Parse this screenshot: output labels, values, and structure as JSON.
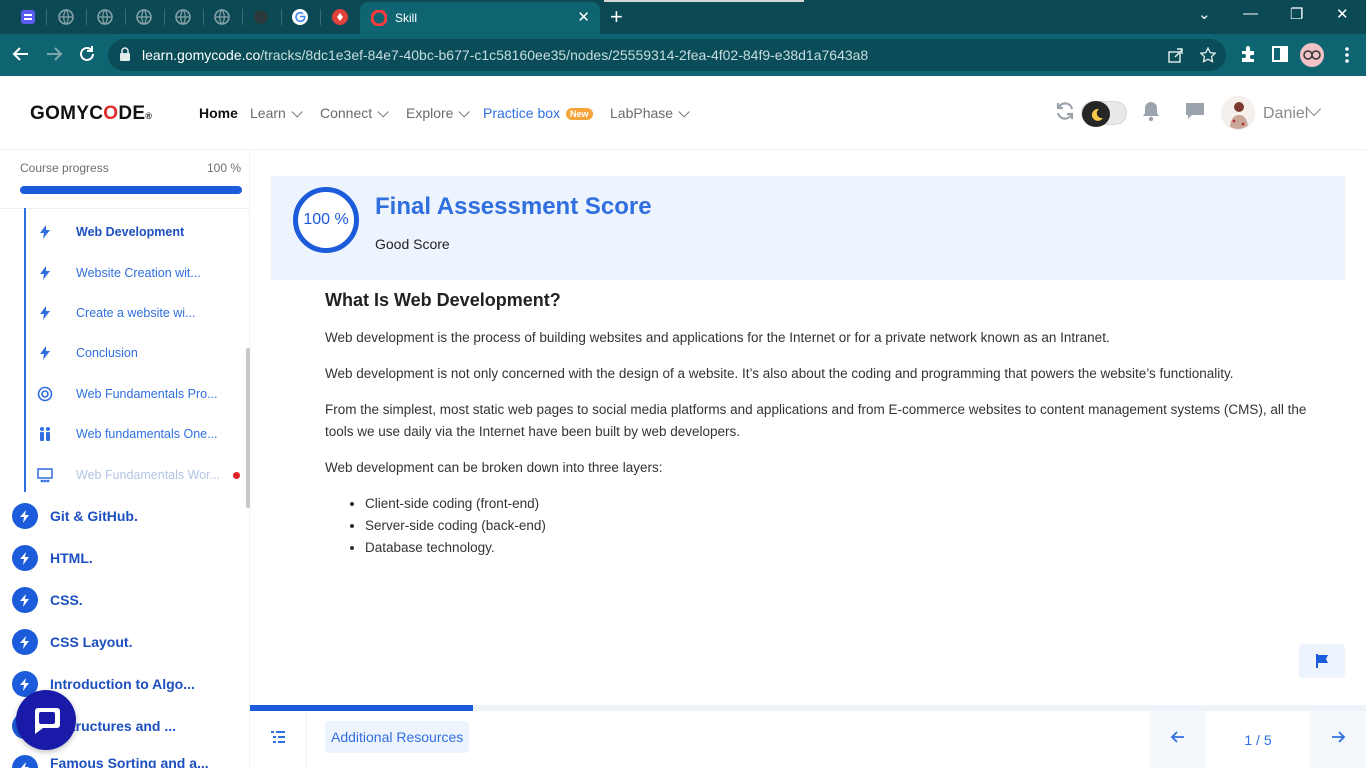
{
  "browser": {
    "active_tab_title": "Skill",
    "url_host": "learn.gomycode.co",
    "url_path": "/tracks/8dc1e3ef-84e7-40bc-b677-c1c58160ee35/nodes/25559314-2fea-4f02-84f9-e38d1a7643a8",
    "new_tab_symbol": "+",
    "close_symbol": "✕",
    "minimize_symbol": "—",
    "restore_symbol": "❐",
    "window_close_symbol": "✕",
    "tab_list_symbol": "⌄"
  },
  "header": {
    "logo_pre": "GOMYC",
    "logo_o": "O",
    "logo_post": "DE",
    "logo_reg": "®",
    "nav": {
      "home": "Home",
      "learn": "Learn",
      "connect": "Connect",
      "explore": "Explore",
      "practice": "Practice box",
      "practice_badge": "New",
      "labphase": "LabPhase"
    },
    "user_name": "Daniel"
  },
  "sidebar": {
    "progress_label": "Course progress",
    "progress_value": "100 %",
    "progress_fraction": 1.0,
    "sub_items": [
      {
        "label": "Web Development",
        "icon": "bolt-icon"
      },
      {
        "label": "Website Creation wit...",
        "icon": "bolt-icon"
      },
      {
        "label": "Create a website wi...",
        "icon": "bolt-icon"
      },
      {
        "label": "Conclusion",
        "icon": "bolt-icon"
      },
      {
        "label": "Web Fundamentals Pro...",
        "icon": "target-icon"
      },
      {
        "label": "Web fundamentals One...",
        "icon": "people-icon"
      },
      {
        "label": "Web Fundamentals Wor...",
        "icon": "workshop-icon"
      }
    ],
    "modules": [
      {
        "label": "Git & GitHub."
      },
      {
        "label": "HTML."
      },
      {
        "label": "CSS."
      },
      {
        "label": "CSS Layout."
      },
      {
        "label": "Introduction to Algo..."
      },
      {
        "label": "a Structures and ..."
      },
      {
        "label": "Famous Sorting and a..."
      }
    ]
  },
  "score": {
    "percent": "100 %",
    "title": "Final Assessment Score",
    "subtitle": "Good Score"
  },
  "article": {
    "heading": "What Is Web Development?",
    "paragraphs": [
      "Web development is the process of building websites and applications for the Internet or for a private network known as an Intranet.",
      "Web development is not only concerned with the design of a website. It’s also about the coding and programming that powers the website’s functionality.",
      "From the simplest, most static web pages to social media platforms and applications and from E-commerce websites to content management systems (CMS), all the tools we use daily via the Internet have been built by web developers.",
      "Web development can be broken down into three layers:"
    ],
    "bullets": [
      "Client-side coding (front-end)",
      "Server-side coding (back-end)",
      "Database technology."
    ]
  },
  "bottom": {
    "resources_label": "Additional Resources",
    "page_indicator": "1 / 5",
    "page_progress_fraction": 0.2
  },
  "colors": {
    "primary": "#1c5bd9",
    "link": "#2f6fdf",
    "browser_frame": "#0b4a55",
    "browser_toolbar": "#0f6472"
  }
}
